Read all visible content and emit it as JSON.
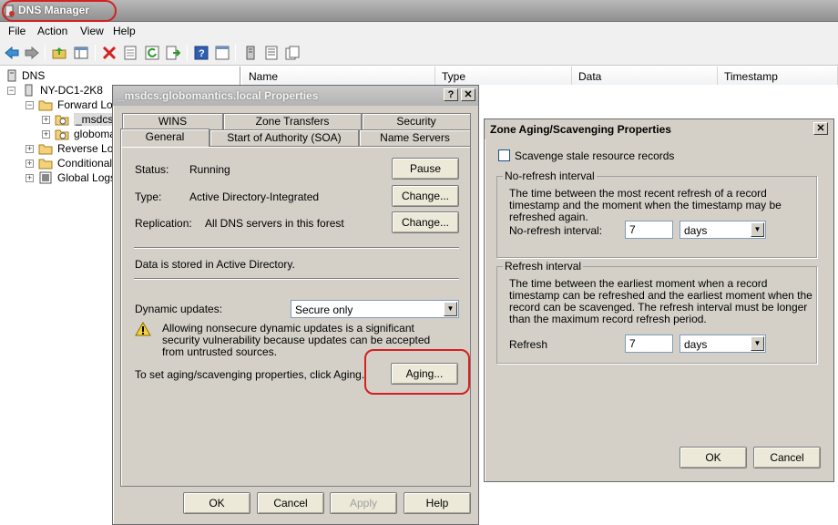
{
  "app": {
    "title": "DNS Manager",
    "menu": [
      "File",
      "Action",
      "View",
      "Help"
    ]
  },
  "toolbar": {
    "icons": [
      "back-arrow-icon",
      "forward-arrow-icon",
      "up-folder-icon",
      "show-hide-tree-icon",
      "delete-icon",
      "properties-icon",
      "refresh-icon",
      "export-list-icon",
      "help-icon",
      "console-icon",
      "list-icon",
      "copy-icon"
    ]
  },
  "tree": {
    "root": "DNS",
    "server": "NY-DC1-2K8",
    "forward": "Forward Loo",
    "msdcs": "_msdcs.",
    "globomantics": "globoma",
    "reverse": "Reverse Loo",
    "conditional": "Conditional F",
    "global_logs": "Global Logs"
  },
  "list": {
    "columns": [
      "Name",
      "Type",
      "Data",
      "Timestamp"
    ]
  },
  "props_dialog": {
    "title": "_msdcs.globomantics.local Properties",
    "help_btn": "?",
    "close_btn": "✕",
    "tabs_back": [
      "WINS",
      "Zone Transfers",
      "Security"
    ],
    "tabs_front": [
      "General",
      "Start of Authority (SOA)",
      "Name Servers"
    ],
    "status_label": "Status:",
    "status_value": "Running",
    "pause_btn": "Pause",
    "type_label": "Type:",
    "type_value": "Active Directory-Integrated",
    "type_change_btn": "Change...",
    "replication_label": "Replication:",
    "replication_value": "All DNS servers in this forest",
    "replication_change_btn": "Change...",
    "stored_text": "Data is stored in Active Directory.",
    "dynamic_label": "Dynamic updates:",
    "dynamic_value": "Secure only",
    "warning_text": "Allowing nonsecure dynamic updates is a significant security vulnerability because updates can be accepted from untrusted sources.",
    "aging_text": "To set aging/scavenging properties, click Aging.",
    "aging_btn": "Aging...",
    "ok_btn": "OK",
    "cancel_btn": "Cancel",
    "apply_btn": "Apply",
    "help_bottom_btn": "Help"
  },
  "aging_dialog": {
    "title": "Zone Aging/Scavenging Properties",
    "close_btn": "✕",
    "scavenge_label": "Scavenge stale resource records",
    "scavenge_checked": false,
    "norefresh_group": "No-refresh interval",
    "norefresh_desc": "The time between the most recent refresh of a record timestamp and the moment when the timestamp may be refreshed again.",
    "norefresh_label": "No-refresh interval:",
    "norefresh_value": "7",
    "norefresh_unit": "days",
    "refresh_group": "Refresh interval",
    "refresh_desc": "The time between the earliest moment when a record timestamp can be refreshed and the earliest moment when the record can be scavenged. The refresh interval must be longer than the maximum record refresh period.",
    "refresh_label": "Refresh",
    "refresh_value": "7",
    "refresh_unit": "days",
    "ok_btn": "OK",
    "cancel_btn": "Cancel"
  }
}
